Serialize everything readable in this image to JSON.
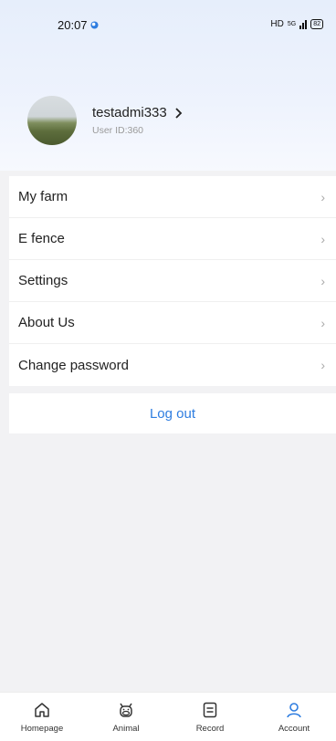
{
  "status": {
    "time": "20:07",
    "network": "HD",
    "signal": "5G",
    "battery": "82"
  },
  "profile": {
    "username": "testadmi333",
    "user_id": "User ID:360"
  },
  "menu": {
    "items": [
      {
        "label": "My farm"
      },
      {
        "label": "E fence"
      },
      {
        "label": "Settings"
      },
      {
        "label": "About Us"
      },
      {
        "label": "Change password"
      }
    ]
  },
  "logout_label": "Log out",
  "tabs": [
    {
      "label": "Homepage",
      "icon": "home-icon"
    },
    {
      "label": "Animal",
      "icon": "cow-icon"
    },
    {
      "label": "Record",
      "icon": "record-icon"
    },
    {
      "label": "Account",
      "icon": "user-icon",
      "active": true
    }
  ],
  "colors": {
    "accent": "#2e7de0",
    "header_bg": "#e6eefb"
  }
}
